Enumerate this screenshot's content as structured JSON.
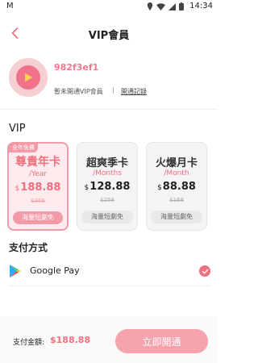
{
  "status_bar": {
    "time": "14:34",
    "left_indicator": "M"
  },
  "nav": {
    "title": "VIP會員",
    "back_icon": "chevron-left-icon"
  },
  "profile": {
    "username": "982f3ef1",
    "vip_status": "暫未開通VIP會員",
    "separator": "|",
    "history_link": "開通記錄"
  },
  "vip_section": {
    "title": "VIP"
  },
  "plans": [
    {
      "badge": "全年免費",
      "name": "尊貴年卡",
      "period": "/Year",
      "currency": "$",
      "price": "188.88",
      "original": "$366",
      "perk": "海量短劇免",
      "selected": true
    },
    {
      "badge": "",
      "name": "超爽季卡",
      "period": "/Months",
      "currency": "$",
      "price": "128.88",
      "original": "$258",
      "perk": "海量短劇免",
      "selected": false
    },
    {
      "badge": "",
      "name": "火爆月卡",
      "period": "/Month",
      "currency": "$",
      "price": "88.88",
      "original": "$168",
      "perk": "海量短劇免",
      "selected": false
    }
  ],
  "payment": {
    "title": "支付方式",
    "method": "Google Pay",
    "selected": true
  },
  "footer": {
    "total_label": "支付金額:",
    "total_amount": "$188.88",
    "submit_label": "立即開通"
  },
  "colors": {
    "accent": "#f0707e",
    "accent_light": "#f29aa7",
    "button": "#f6a3ae"
  }
}
